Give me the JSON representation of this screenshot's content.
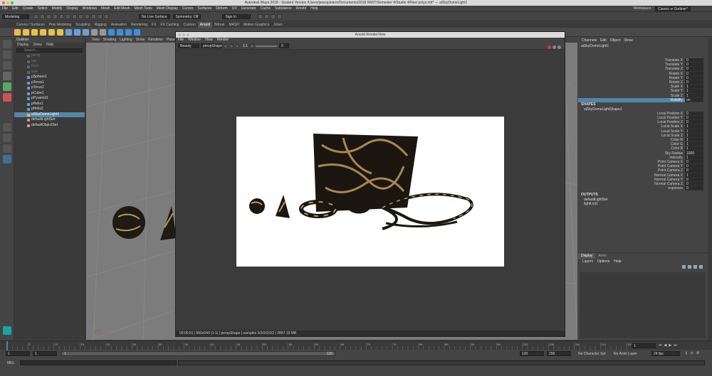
{
  "window": {
    "title": "Autodesk Maya 2018 - Student Version  /Users/janequintero/Documents/2018 RMIT/Semester 4/Studio 4/New polys.mb*   ---   aiSkyDomeLight1"
  },
  "menubar": {
    "items": [
      "File",
      "Edit",
      "Create",
      "Select",
      "Modify",
      "Display",
      "Windows",
      "Mesh",
      "Edit Mesh",
      "Mesh Tools",
      "Mesh Display",
      "Curves",
      "Surfaces",
      "Deform",
      "UV",
      "Generate",
      "Cache",
      "Substance",
      "Arnold",
      "Help"
    ],
    "workspace_label": "Workspace :",
    "workspace_value": "Classic w Outliner*"
  },
  "statusline": {
    "menuset": "Modeling",
    "live_surface": "No Live Surface",
    "symmetry": "Symmetry: Off",
    "sign_in": "Sign In"
  },
  "shelf": {
    "tabs": [
      "Curves / Surfaces",
      "Poly Modeling",
      "Sculpting",
      "Rigging",
      "Animation",
      "Rendering",
      "FX",
      "FX Caching",
      "Custom",
      "Arnold",
      "Bifrost",
      "MASH",
      "Motion Graphics",
      "XGen"
    ],
    "active_tab": "Arnold"
  },
  "outliner": {
    "title": "Outliner",
    "menu": [
      "Display",
      "Show",
      "Help"
    ],
    "search_placeholder": "Search...",
    "items": [
      {
        "label": "persp",
        "dim": true,
        "selected": false
      },
      {
        "label": "top",
        "dim": true,
        "selected": false
      },
      {
        "label": "front",
        "dim": true,
        "selected": false
      },
      {
        "label": "side",
        "dim": true,
        "selected": false
      },
      {
        "label": "pSphere1",
        "dim": false,
        "selected": false
      },
      {
        "label": "pTorus1",
        "dim": false,
        "selected": false
      },
      {
        "label": "pTorus2",
        "dim": false,
        "selected": false
      },
      {
        "label": "pCube1",
        "dim": false,
        "selected": false
      },
      {
        "label": "pPyramid1",
        "dim": false,
        "selected": false
      },
      {
        "label": "pHelix1",
        "dim": false,
        "selected": false
      },
      {
        "label": "pHelix2",
        "dim": false,
        "selected": false
      },
      {
        "label": "aiSkyDomeLight1",
        "dim": false,
        "selected": true
      },
      {
        "label": "defaultLightSet",
        "dim": false,
        "selected": false
      },
      {
        "label": "defaultObjectSet",
        "dim": false,
        "selected": false
      }
    ]
  },
  "viewport": {
    "menu": [
      "View",
      "Shading",
      "Lighting",
      "Show",
      "Renderer",
      "Panels"
    ]
  },
  "renderview": {
    "title": "Arnold RenderView",
    "menu": [
      "File",
      "Window",
      "View",
      "Render"
    ],
    "aov": "Beauty",
    "camera": "perspShape",
    "ratio": "1:1",
    "exposure": "0",
    "status": "00:00:01 | 960x540 (1:1) | perspShape | samples 3/2/2/2/2/2 | 2897.19 MB"
  },
  "channelbox": {
    "tabs": [
      "Channels",
      "Edit",
      "Object",
      "Show"
    ],
    "object": "aiSkyDomeLight1",
    "transform_attrs": [
      {
        "name": "Translate X",
        "value": "0"
      },
      {
        "name": "Translate Y",
        "value": "0"
      },
      {
        "name": "Translate Z",
        "value": "0"
      },
      {
        "name": "Rotate X",
        "value": "0"
      },
      {
        "name": "Rotate Y",
        "value": "0"
      },
      {
        "name": "Rotate Z",
        "value": "0"
      },
      {
        "name": "Scale X",
        "value": "1"
      },
      {
        "name": "Scale Y",
        "value": "1"
      },
      {
        "name": "Scale Z",
        "value": "1"
      },
      {
        "name": "Visibility",
        "value": "on",
        "highlight": true
      }
    ],
    "shapes_label": "SHAPES",
    "shape_name": "aiSkyDomeLightShape1",
    "shape_attrs": [
      {
        "name": "Local Position X",
        "value": "0"
      },
      {
        "name": "Local Position Y",
        "value": "0"
      },
      {
        "name": "Local Position Z",
        "value": "0"
      },
      {
        "name": "Local Scale X",
        "value": "1"
      },
      {
        "name": "Local Scale Y",
        "value": "1"
      },
      {
        "name": "Local Scale Z",
        "value": "1"
      },
      {
        "name": "Color R",
        "value": "1"
      },
      {
        "name": "Color G",
        "value": "1"
      },
      {
        "name": "Color B",
        "value": "1"
      },
      {
        "name": "Sky Radius",
        "value": "1000"
      },
      {
        "name": "Intensity",
        "value": "1"
      },
      {
        "name": "Point Camera X",
        "value": "0"
      },
      {
        "name": "Point Camera Y",
        "value": "0"
      },
      {
        "name": "Point Camera Z",
        "value": "0"
      },
      {
        "name": "Normal Camera X",
        "value": "1"
      },
      {
        "name": "Normal Camera Y",
        "value": "0"
      },
      {
        "name": "Normal Camera Z",
        "value": "0"
      },
      {
        "name": "exposure",
        "value": "0"
      }
    ],
    "outputs_label": "OUTPUTS",
    "outputs": [
      "defaultLightSet",
      "lightList1"
    ]
  },
  "layers": {
    "tabs": [
      "Display",
      "Anim"
    ],
    "menu": [
      "Layers",
      "Options",
      "Help"
    ]
  },
  "timeslider": {
    "ticks": [
      "5",
      "10",
      "15",
      "20",
      "25",
      "30",
      "35",
      "40",
      "45",
      "50",
      "55",
      "60",
      "65",
      "70",
      "75",
      "80",
      "85",
      "90",
      "95",
      "100",
      "105",
      "110",
      "115",
      "120"
    ],
    "current_frame": "1"
  },
  "range": {
    "start": "1",
    "playback_start": "1",
    "range_start_field": "1",
    "range_end_field": "120",
    "playback_end": "120",
    "end": "200",
    "character_set": "No Character Set",
    "anim_layer": "No Anim Layer",
    "fps": "24 fps"
  },
  "mel": {
    "label": "MEL"
  }
}
